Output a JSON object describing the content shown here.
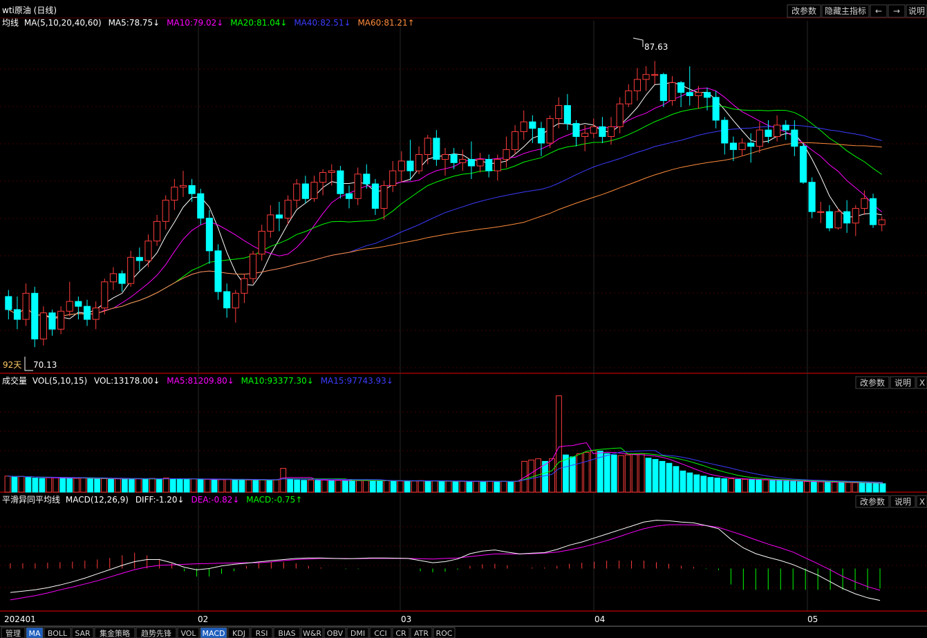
{
  "header": {
    "title": "wti原油 (日线)"
  },
  "top_buttons": [
    "改参数",
    "隐藏主指标"
  ],
  "nav": {
    "left": "←",
    "right": "→",
    "help": "说明"
  },
  "ma_panel": {
    "name": "均线",
    "params": "MA(5,10,20,40,60)",
    "ma5": "MA5:78.75↓",
    "ma10": "MA10:79.02↓",
    "ma20": "MA20:81.04↓",
    "ma40": "MA40:82.51↓",
    "ma60": "MA60:81.21↑",
    "high_label": "87.63",
    "low_label": "70.13",
    "days_label": "92天"
  },
  "vol_panel": {
    "name": "成交量",
    "params": "VOL(5,10,15)",
    "vol": "VOL:13178.00↓",
    "ma5": "MA5:81209.80↓",
    "ma10": "MA10:93377.30↓",
    "ma15": "MA15:97743.93↓",
    "btn_params": "改参数",
    "btn_help": "说明",
    "btn_close": "X"
  },
  "macd_panel": {
    "name": "平滑异同平均线",
    "params": "MACD(12,26,9)",
    "diff": "DIFF:-1.20↓",
    "dea": "DEA:-0.82↓",
    "macd": "MACD:-0.75↑",
    "btn_params": "改参数",
    "btn_help": "说明",
    "btn_close": "X"
  },
  "x_axis": [
    "202401",
    "02",
    "03",
    "04",
    "05"
  ],
  "tabs": [
    "管理",
    "MA",
    "BOLL",
    "SAR",
    "集金策略",
    "趋势先锋",
    "VOL",
    "MACD",
    "KDJ",
    "RSI",
    "BIAS",
    "W&R",
    "OBV",
    "DMI",
    "CCI",
    "CR",
    "ATR",
    "ROC"
  ],
  "active_tabs": [
    "MA",
    "MACD"
  ],
  "colors": {
    "up": "#ff3c3c",
    "down": "#00ffff",
    "ma5": "#ffffff",
    "ma10": "#ff00ff",
    "ma20": "#00ff00",
    "ma40": "#3c3cff",
    "ma60": "#ff8c3c",
    "grid": "#8b0000"
  },
  "chart_data": [
    {
      "type": "candlestick",
      "title": "wti原油 (日线)",
      "series_name": "wti原油",
      "ylim": [
        68.5,
        89.5
      ],
      "x_labels": [
        "202401",
        "02",
        "03",
        "04",
        "05"
      ],
      "candles": [
        [
          73.2,
          72.4,
          73.6,
          71.8
        ],
        [
          72.4,
          71.8,
          73.2,
          71.2
        ],
        [
          71.8,
          73.4,
          74.0,
          71.4
        ],
        [
          73.4,
          70.6,
          73.8,
          70.1
        ],
        [
          70.6,
          72.2,
          72.6,
          70.2
        ],
        [
          72.2,
          71.2,
          72.4,
          70.8
        ],
        [
          71.2,
          72.3,
          72.6,
          70.9
        ],
        [
          72.3,
          72.9,
          74.1,
          72.0
        ],
        [
          72.9,
          72.6,
          73.2,
          71.8
        ],
        [
          72.6,
          71.8,
          73.0,
          71.4
        ],
        [
          71.8,
          72.5,
          72.9,
          71.2
        ],
        [
          72.5,
          74.1,
          74.3,
          72.1
        ],
        [
          74.1,
          74.6,
          75.0,
          73.6
        ],
        [
          74.6,
          74.0,
          74.8,
          73.5
        ],
        [
          74.0,
          75.6,
          76.0,
          73.8
        ],
        [
          75.6,
          75.4,
          76.2,
          74.8
        ],
        [
          75.4,
          76.6,
          77.0,
          75.0
        ],
        [
          76.6,
          77.8,
          78.2,
          76.3
        ],
        [
          77.8,
          79.1,
          79.4,
          77.3
        ],
        [
          79.1,
          79.9,
          80.4,
          78.5
        ],
        [
          79.9,
          80.0,
          80.9,
          79.3
        ],
        [
          80.0,
          79.5,
          80.4,
          79.0
        ],
        [
          79.5,
          78.0,
          79.8,
          77.6
        ],
        [
          78.0,
          76.0,
          78.5,
          75.2
        ],
        [
          76.0,
          73.5,
          76.4,
          73.0
        ],
        [
          73.5,
          72.5,
          74.0,
          71.9
        ],
        [
          72.5,
          73.4,
          73.6,
          71.6
        ],
        [
          73.4,
          74.3,
          74.6,
          72.8
        ],
        [
          74.3,
          75.8,
          76.0,
          74.0
        ],
        [
          75.8,
          77.2,
          77.6,
          75.4
        ],
        [
          77.2,
          78.2,
          78.8,
          76.8
        ],
        [
          78.2,
          78.0,
          79.0,
          77.2
        ],
        [
          78.0,
          79.1,
          79.4,
          77.6
        ],
        [
          79.1,
          80.1,
          80.4,
          78.6
        ],
        [
          80.1,
          79.2,
          80.6,
          78.9
        ],
        [
          79.2,
          80.2,
          80.6,
          79.0
        ],
        [
          80.2,
          80.8,
          81.0,
          79.4
        ],
        [
          80.8,
          80.9,
          81.3,
          80.0
        ],
        [
          80.9,
          79.5,
          81.2,
          79.2
        ],
        [
          79.5,
          79.2,
          80.0,
          78.6
        ],
        [
          79.2,
          80.7,
          81.1,
          78.8
        ],
        [
          80.7,
          80.1,
          81.3,
          79.8
        ],
        [
          80.1,
          78.6,
          80.4,
          78.2
        ],
        [
          78.6,
          80.0,
          80.3,
          77.9
        ],
        [
          80.0,
          80.9,
          81.5,
          79.6
        ],
        [
          80.9,
          81.5,
          82.1,
          80.2
        ],
        [
          81.5,
          80.9,
          82.8,
          80.3
        ],
        [
          80.9,
          81.9,
          82.4,
          80.7
        ],
        [
          81.9,
          82.9,
          83.1,
          81.3
        ],
        [
          82.9,
          81.6,
          83.4,
          81.2
        ],
        [
          81.6,
          81.9,
          82.3,
          80.6
        ],
        [
          81.9,
          81.4,
          82.3,
          81.0
        ],
        [
          81.4,
          81.6,
          82.2,
          80.9
        ],
        [
          81.6,
          81.2,
          82.7,
          80.4
        ],
        [
          81.2,
          81.6,
          82.0,
          80.8
        ],
        [
          81.6,
          80.9,
          81.9,
          80.5
        ],
        [
          80.9,
          81.6,
          81.9,
          80.3
        ],
        [
          81.6,
          82.2,
          83.0,
          81.1
        ],
        [
          82.2,
          83.3,
          83.7,
          81.9
        ],
        [
          83.3,
          83.9,
          84.6,
          82.8
        ],
        [
          83.9,
          83.5,
          84.3,
          82.6
        ],
        [
          83.5,
          82.6,
          83.9,
          81.8
        ],
        [
          82.6,
          84.1,
          84.3,
          82.3
        ],
        [
          84.1,
          84.9,
          85.4,
          83.5
        ],
        [
          84.9,
          83.8,
          85.6,
          83.4
        ],
        [
          83.8,
          83.0,
          84.0,
          82.4
        ],
        [
          83.0,
          83.2,
          83.7,
          82.1
        ],
        [
          83.2,
          83.6,
          84.1,
          82.9
        ],
        [
          83.6,
          83.0,
          84.2,
          82.6
        ],
        [
          83.0,
          83.6,
          84.2,
          82.5
        ],
        [
          83.6,
          85.0,
          85.4,
          83.2
        ],
        [
          85.0,
          85.8,
          86.2,
          84.8
        ],
        [
          85.8,
          86.5,
          87.2,
          85.2
        ],
        [
          86.5,
          86.8,
          87.3,
          85.8
        ],
        [
          86.8,
          86.8,
          87.63,
          86.2
        ],
        [
          86.8,
          85.2,
          86.9,
          84.8
        ],
        [
          85.2,
          86.3,
          86.7,
          84.9
        ],
        [
          86.3,
          85.7,
          86.4,
          84.8
        ],
        [
          85.7,
          85.5,
          87.3,
          84.9
        ],
        [
          85.5,
          85.7,
          86.1,
          84.7
        ],
        [
          85.7,
          85.4,
          86.0,
          84.6
        ],
        [
          85.4,
          84.0,
          85.8,
          83.5
        ],
        [
          84.0,
          82.6,
          84.2,
          81.9
        ],
        [
          82.6,
          82.2,
          83.0,
          81.5
        ],
        [
          82.2,
          82.6,
          82.9,
          81.8
        ],
        [
          82.6,
          82.4,
          83.2,
          81.4
        ],
        [
          82.4,
          83.4,
          83.9,
          82.0
        ],
        [
          83.4,
          83.0,
          84.0,
          82.6
        ],
        [
          83.0,
          83.7,
          84.3,
          82.7
        ],
        [
          83.7,
          83.4,
          84.0,
          82.8
        ],
        [
          83.4,
          82.4,
          84.0,
          81.8
        ],
        [
          82.4,
          80.2,
          82.6,
          80.1
        ],
        [
          80.2,
          78.4,
          80.5,
          78.0
        ],
        [
          78.4,
          78.4,
          79.0,
          77.7
        ],
        [
          78.4,
          77.4,
          78.8,
          77.2
        ],
        [
          77.4,
          78.4,
          78.6,
          77.3
        ],
        [
          78.4,
          77.7,
          79.1,
          77.1
        ],
        [
          77.7,
          78.6,
          78.8,
          76.9
        ],
        [
          78.6,
          79.2,
          79.7,
          78.2
        ],
        [
          79.2,
          77.6,
          79.5,
          77.4
        ],
        [
          77.6,
          77.9,
          78.1,
          77.2
        ]
      ],
      "volume_ylim": [
        0,
        155000
      ],
      "volumes": [
        25000,
        24000,
        24500,
        23000,
        22000,
        21500,
        22500,
        23000,
        22000,
        21000,
        21500,
        22500,
        21000,
        20500,
        21000,
        20000,
        21500,
        21000,
        20500,
        21000,
        20000,
        21500,
        20000,
        22000,
        21000,
        20500,
        20000,
        20500,
        19500,
        20000,
        19000,
        19500,
        20000,
        19500,
        19000,
        19000,
        18500,
        19000,
        18500,
        19000,
        37000,
        20000,
        19000,
        18500,
        19000,
        18500,
        19000,
        18000,
        18500,
        18000,
        17500,
        18000,
        18500,
        18000,
        17500,
        18000,
        17000,
        17500,
        17000,
        17500,
        18000,
        17000,
        17500,
        17000,
        17000,
        16500,
        17000,
        16500,
        17000,
        16500,
        17000,
        16500,
        17000,
        16500,
        17000,
        48000,
        50000,
        52000,
        48000,
        52000,
        150000,
        58000,
        55000,
        60000,
        62000,
        65000,
        64000,
        60000,
        58000,
        57000,
        58000,
        59000,
        60000,
        53000,
        51000,
        48000,
        45000,
        40000,
        33000,
        30000,
        27000,
        25000,
        23000,
        22000,
        21000,
        21000,
        20000,
        20000,
        19500,
        19000,
        19000,
        18500,
        18000,
        17500,
        17000,
        16500,
        16500,
        16000,
        16000,
        15500,
        15500,
        15000,
        15000,
        14800,
        14500,
        14000,
        13500,
        13178
      ]
    },
    {
      "type": "macd",
      "title": "MACD(12,26,9)",
      "ylim": [
        -1.6,
        2.2
      ],
      "diff": [
        -0.9,
        -0.85,
        -0.8,
        -0.72,
        -0.62,
        -0.5,
        -0.36,
        -0.2,
        -0.04,
        0.12,
        0.26,
        0.34,
        0.34,
        0.22,
        0.05,
        -0.05,
        0.0,
        0.1,
        0.16,
        0.2,
        0.25,
        0.3,
        0.34,
        0.38,
        0.4,
        0.4,
        0.38,
        0.37,
        0.38,
        0.4,
        0.4,
        0.39,
        0.38,
        0.3,
        0.22,
        0.26,
        0.36,
        0.56,
        0.66,
        0.7,
        0.62,
        0.55,
        0.58,
        0.6,
        0.72,
        0.88,
        1.0,
        1.15,
        1.3,
        1.45,
        1.6,
        1.75,
        1.82,
        1.8,
        1.75,
        1.72,
        1.62,
        1.5,
        1.1,
        0.78,
        0.56,
        0.42,
        0.3,
        0.15,
        -0.05,
        -0.25,
        -0.5,
        -0.75,
        -0.95,
        -1.1,
        -1.2
      ],
      "dea": [
        -1.18,
        -1.1,
        -1.02,
        -0.92,
        -0.8,
        -0.7,
        -0.58,
        -0.46,
        -0.32,
        -0.18,
        -0.04,
        0.06,
        0.12,
        0.14,
        0.16,
        0.18,
        0.19,
        0.2,
        0.21,
        0.22,
        0.22,
        0.25,
        0.3,
        0.34,
        0.36,
        0.38,
        0.38,
        0.38,
        0.37,
        0.38,
        0.38,
        0.38,
        0.38,
        0.37,
        0.36,
        0.38,
        0.4,
        0.45,
        0.5,
        0.55,
        0.55,
        0.55,
        0.56,
        0.58,
        0.62,
        0.7,
        0.8,
        0.92,
        1.05,
        1.2,
        1.36,
        1.5,
        1.6,
        1.65,
        1.65,
        1.64,
        1.62,
        1.55,
        1.4,
        1.25,
        1.08,
        0.92,
        0.78,
        0.62,
        0.4,
        0.18,
        -0.05,
        -0.3,
        -0.5,
        -0.68,
        -0.82
      ],
      "macd": [
        0.2,
        0.2,
        0.2,
        0.22,
        0.24,
        0.26,
        0.3,
        0.34,
        0.4,
        0.5,
        0.6,
        0.5,
        0.36,
        0.2,
        -0.1,
        -0.3,
        -0.3,
        -0.2,
        -0.1,
        0.1,
        0.2,
        0.24,
        0.24,
        0.2,
        0.1,
        0.04,
        0.0,
        -0.02,
        -0.02,
        0.0,
        0.0,
        0.0,
        0.0,
        -0.1,
        -0.14,
        -0.12,
        -0.04,
        0.1,
        0.16,
        0.18,
        0.12,
        0.0,
        0.04,
        0.04,
        0.1,
        0.18,
        0.22,
        0.26,
        0.3,
        0.3,
        0.3,
        0.3,
        0.24,
        0.18,
        0.1,
        0.06,
        -0.02,
        -0.06,
        -0.6,
        -0.8,
        -0.8,
        -0.8,
        -0.8,
        -0.8,
        -0.8,
        -0.8,
        -0.8,
        -0.8,
        -0.8,
        -0.8,
        -0.75
      ]
    }
  ]
}
